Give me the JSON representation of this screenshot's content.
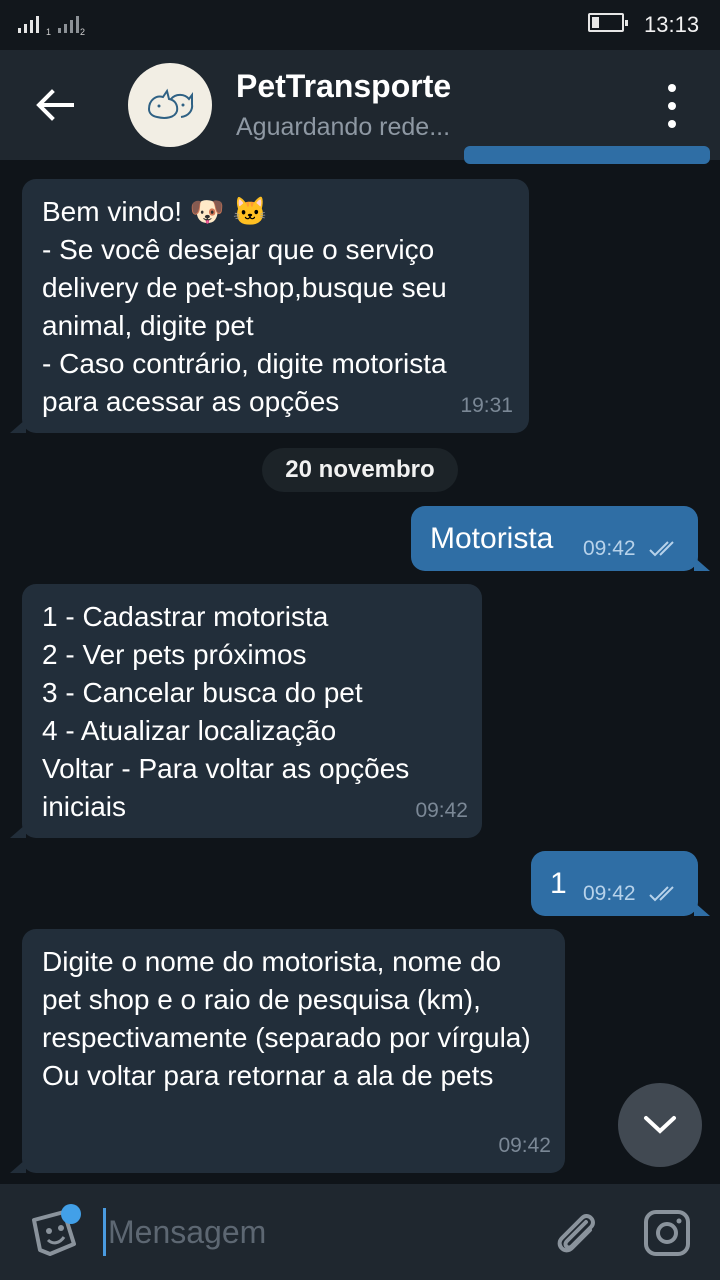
{
  "status_bar": {
    "time": "13:13",
    "sim1": "1",
    "sim2": "2"
  },
  "header": {
    "title": "PetTransporte",
    "subtitle": "Aguardando rede..."
  },
  "messages": [
    {
      "direction": "in",
      "text": "Bem vindo! 🐶 🐱\n- Se você desejar que o serviço delivery de pet-shop,busque seu animal, digite pet\n- Caso contrário, digite motorista para acessar as opções",
      "time": "19:31"
    },
    {
      "direction": "out",
      "text": "Motorista",
      "time": "09:42",
      "status": "read"
    },
    {
      "direction": "in",
      "text": "1 - Cadastrar motorista\n2 - Ver pets próximos\n3 - Cancelar busca do pet\n4 - Atualizar localização\nVoltar - Para voltar as opções iniciais",
      "time": "09:42"
    },
    {
      "direction": "out",
      "text": "1",
      "time": "09:42",
      "status": "read"
    },
    {
      "direction": "in",
      "text": "Digite o nome do motorista, nome do pet shop e o raio de pesquisa (km), respectivamente (separado por vírgula)\nOu voltar para retornar a ala de pets",
      "time": "09:42"
    }
  ],
  "date_separator": "20 novembro",
  "composer": {
    "placeholder": "Mensagem",
    "value": ""
  },
  "icons": {
    "back": "arrow-left-icon",
    "menu": "more-vertical-icon",
    "avatar": "pet-logo-icon",
    "scroll": "chevron-down-icon",
    "sticker": "sticker-icon",
    "attach": "paperclip-icon",
    "camera": "camera-icon",
    "ticks": "double-check-icon"
  },
  "colors": {
    "background": "#0f1419",
    "header": "#1f272f",
    "incoming_bubble": "#222e3a",
    "outgoing_bubble": "#2f6ea5",
    "accent": "#42a0e8"
  }
}
